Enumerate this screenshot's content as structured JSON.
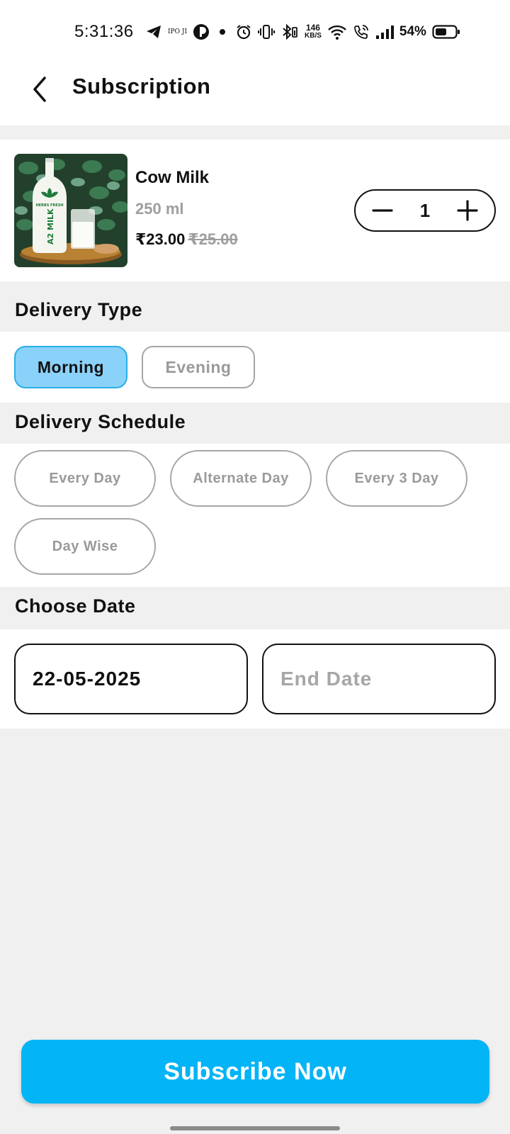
{
  "status_bar": {
    "time": "5:31:36",
    "carrier_text": "IPO JI",
    "speed_value": "146",
    "speed_unit": "KB/S",
    "battery_percent": "54%",
    "icons": [
      "telegram-icon",
      "app-icon",
      "dot-icon",
      "alarm-icon",
      "vibrate-icon",
      "bluetooth-icon",
      "wifi-icon",
      "wifi-calling-icon",
      "signal-icon",
      "battery-icon"
    ]
  },
  "header": {
    "title": "Subscription",
    "back_icon": "chevron-left-icon"
  },
  "product": {
    "image_label": "A2 MILK",
    "image_brand": "HERBS FRESH",
    "name": "Cow Milk",
    "size": "250 ml",
    "price": "₹23.00",
    "mrp": "₹25.00",
    "quantity": "1"
  },
  "delivery_type": {
    "title": "Delivery Type",
    "options": [
      "Morning",
      "Evening"
    ],
    "selected": "Morning"
  },
  "delivery_schedule": {
    "title": "Delivery Schedule",
    "options": [
      "Every Day",
      "Alternate Day",
      "Every 3 Day",
      "Day Wise"
    ]
  },
  "choose_date": {
    "title": "Choose Date",
    "start_date": "22-05-2025",
    "end_date_placeholder": "End Date"
  },
  "subscribe_button": "Subscribe Now",
  "colors": {
    "accent": "#03b4f6",
    "selected_pill_bg": "#8bd2fb",
    "selected_pill_border": "#29aee8",
    "muted_text": "#9e9e9e",
    "section_bg": "#f0f0f0"
  }
}
